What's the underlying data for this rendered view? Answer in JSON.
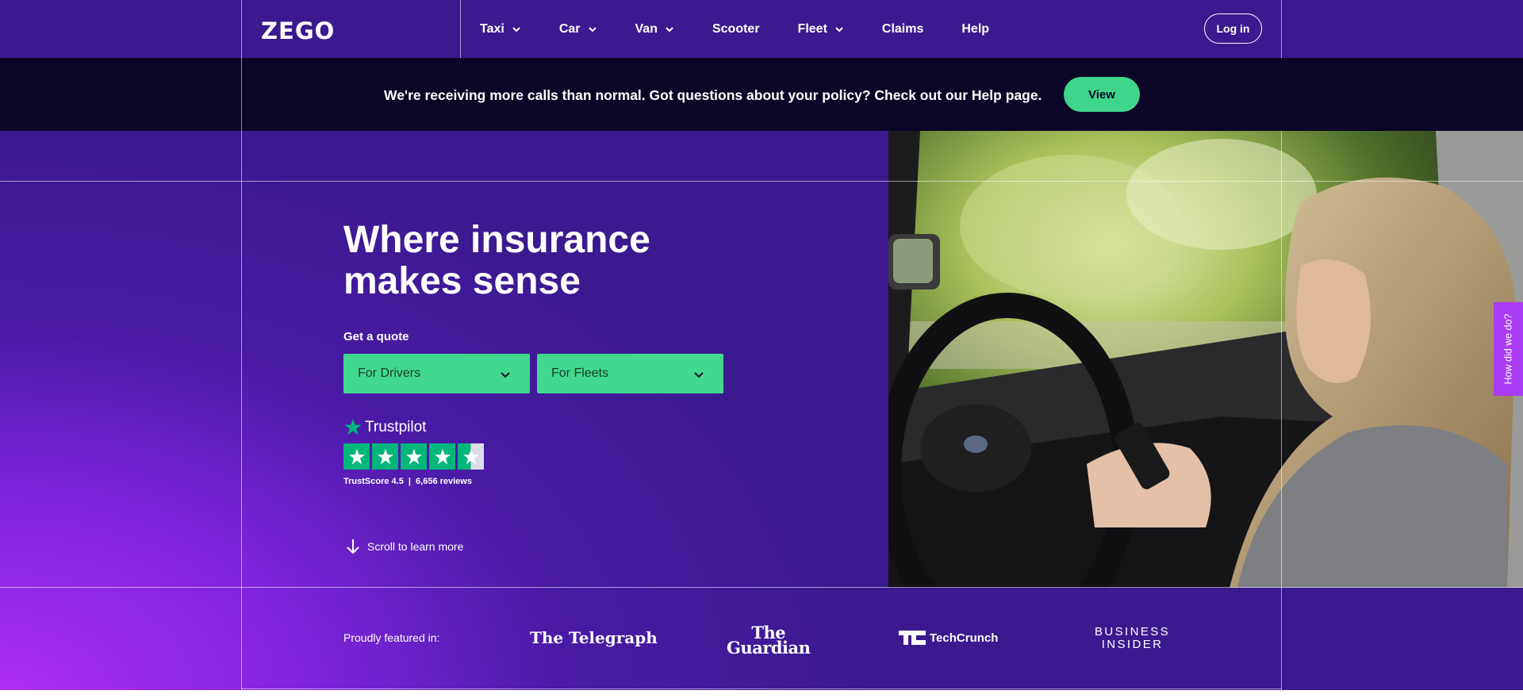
{
  "brand": {
    "logo_text": "ZEGO"
  },
  "nav": {
    "items": [
      {
        "label": "Taxi",
        "has_dropdown": true
      },
      {
        "label": "Car",
        "has_dropdown": true
      },
      {
        "label": "Van",
        "has_dropdown": true
      },
      {
        "label": "Scooter",
        "has_dropdown": false
      },
      {
        "label": "Fleet",
        "has_dropdown": true
      },
      {
        "label": "Claims",
        "has_dropdown": false
      },
      {
        "label": "Help",
        "has_dropdown": false
      }
    ],
    "login_label": "Log in"
  },
  "banner": {
    "text": "We're receiving more calls than normal. Got questions about your policy? Check out our Help page.",
    "button_label": "View"
  },
  "hero": {
    "title_line1": "Where insurance",
    "title_line2": "makes sense",
    "quote_label": "Get a quote",
    "selects": [
      {
        "label": "For Drivers"
      },
      {
        "label": "For Fleets"
      }
    ]
  },
  "trustpilot": {
    "name": "Trustpilot",
    "stars": 4.5,
    "score_text": "TrustScore 4.5",
    "separator": "|",
    "reviews_text": "6,656 reviews"
  },
  "scroll": {
    "label": "Scroll to learn more"
  },
  "feedback": {
    "label": "How did we do?"
  },
  "featured": {
    "label": "Proudly featured in:",
    "publications": [
      {
        "name": "The Telegraph"
      },
      {
        "name_line1": "The",
        "name_line2": "Guardian"
      },
      {
        "name": "TechCrunch"
      },
      {
        "name_line1": "BUSINESS",
        "name_line2": "INSIDER"
      }
    ]
  },
  "colors": {
    "primary_purple": "#3a1a8e",
    "accent_green": "#42d98f",
    "banner_dark": "#0b0628",
    "feedback_purple": "#a93cf3",
    "trustpilot_green": "#00b67a"
  }
}
